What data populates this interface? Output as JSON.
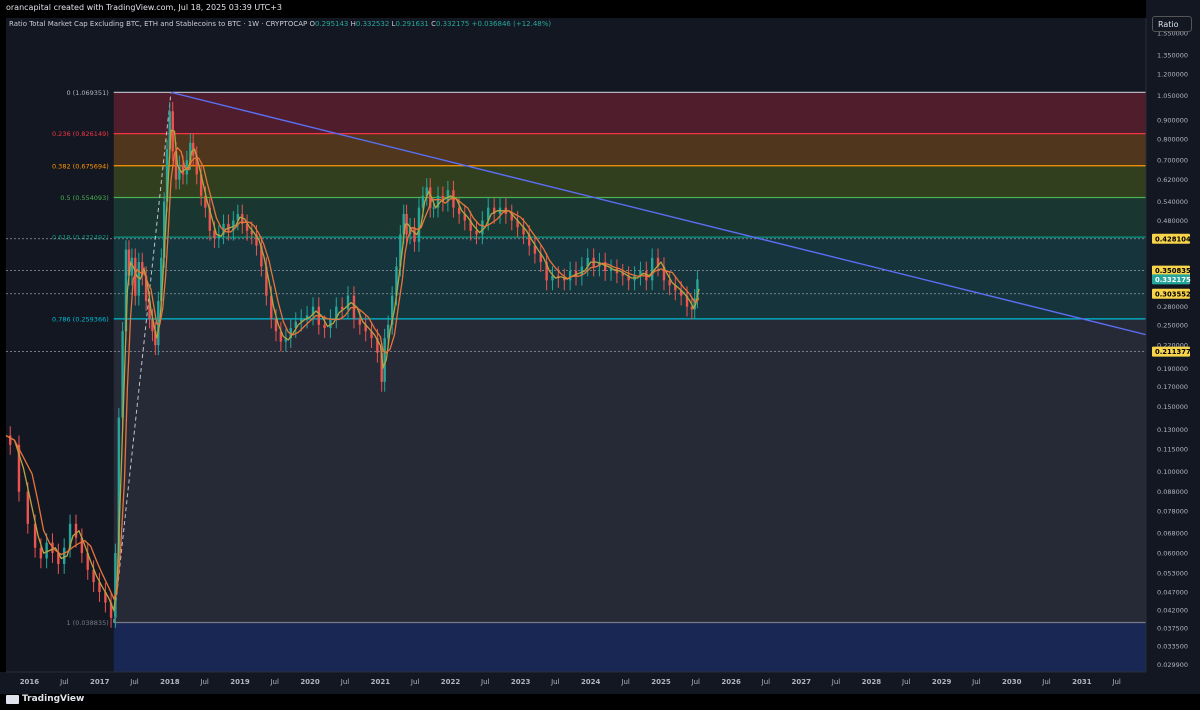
{
  "header": {
    "creator_text": "orancapital created with TradingView.com, Jul 18, 2025 03:39 UTC+3"
  },
  "legend": {
    "symbol": "Ratio Total Market Cap Excluding BTC, ETH and Stablecoins to BTC · 1W · CRYPTOCAP",
    "open_label": "O",
    "open": "0.295143",
    "high_label": "H",
    "high": "0.332532",
    "low_label": "L",
    "low": "0.291631",
    "close_label": "C",
    "close": "0.332175",
    "change": "+0.036846 (+12.48%)"
  },
  "axis_label": "Ratio",
  "brand": "TradingView",
  "colors": {
    "background": "#000000",
    "up": "#26a69a",
    "down": "#ef5350",
    "trendline": "#5b6ef5",
    "ma_fast": "#b5a642",
    "ma_slow": "#e8743b"
  },
  "chart_data": {
    "type": "candlestick",
    "title": "Ratio Total Market Cap Excluding BTC, ETH and Stablecoins to BTC · 1W · CRYPTOCAP",
    "scale": "log",
    "ylabel": "Ratio",
    "ylim": [
      0.0285,
      1.56
    ],
    "xlim": [
      "2015-09-01",
      "2031-12-01"
    ],
    "y_ticks": [
      "1.550000",
      "1.350000",
      "1.200000",
      "1.050000",
      "0.900000",
      "0.800000",
      "0.700000",
      "0.620000",
      "0.540000",
      "0.480000",
      "0.350000",
      "0.280000",
      "0.250000",
      "0.220000",
      "0.190000",
      "0.170000",
      "0.150000",
      "0.130000",
      "0.115000",
      "0.100000",
      "0.088000",
      "0.078000",
      "0.068000",
      "0.060000",
      "0.053000",
      "0.047000",
      "0.042000",
      "0.037500",
      "0.033500",
      "0.029900"
    ],
    "x_ticks": [
      {
        "label": "2016",
        "date": "2016-01-01"
      },
      {
        "label": "Jul",
        "date": "2016-07-01"
      },
      {
        "label": "2017",
        "date": "2017-01-01"
      },
      {
        "label": "Jul",
        "date": "2017-07-01"
      },
      {
        "label": "2018",
        "date": "2018-01-01"
      },
      {
        "label": "Jul",
        "date": "2018-07-01"
      },
      {
        "label": "2019",
        "date": "2019-01-01"
      },
      {
        "label": "Jul",
        "date": "2019-07-01"
      },
      {
        "label": "2020",
        "date": "2020-01-01"
      },
      {
        "label": "Jul",
        "date": "2020-07-01"
      },
      {
        "label": "2021",
        "date": "2021-01-01"
      },
      {
        "label": "Jul",
        "date": "2021-07-01"
      },
      {
        "label": "2022",
        "date": "2022-01-01"
      },
      {
        "label": "Jul",
        "date": "2022-07-01"
      },
      {
        "label": "2023",
        "date": "2023-01-01"
      },
      {
        "label": "Jul",
        "date": "2023-07-01"
      },
      {
        "label": "2024",
        "date": "2024-01-01"
      },
      {
        "label": "Jul",
        "date": "2024-07-01"
      },
      {
        "label": "2025",
        "date": "2025-01-01"
      },
      {
        "label": "Jul",
        "date": "2025-07-01"
      },
      {
        "label": "2026",
        "date": "2026-01-01"
      },
      {
        "label": "Jul",
        "date": "2026-07-01"
      },
      {
        "label": "2027",
        "date": "2027-01-01"
      },
      {
        "label": "Jul",
        "date": "2027-07-01"
      },
      {
        "label": "2028",
        "date": "2028-01-01"
      },
      {
        "label": "Jul",
        "date": "2028-07-01"
      },
      {
        "label": "2029",
        "date": "2029-01-01"
      },
      {
        "label": "Jul",
        "date": "2029-07-01"
      },
      {
        "label": "2030",
        "date": "2030-01-01"
      },
      {
        "label": "Jul",
        "date": "2030-07-01"
      },
      {
        "label": "2031",
        "date": "2031-01-01"
      },
      {
        "label": "Jul",
        "date": "2031-07-01"
      }
    ],
    "fib_levels": [
      {
        "label": "0 (1.069351)",
        "value": 1.069351,
        "color": "#b2b5be",
        "fill": "#5c1f2e"
      },
      {
        "label": "0.236 (0.826149)",
        "value": 0.826149,
        "color": "#f23645",
        "fill": "#5a3c1c"
      },
      {
        "label": "0.382 (0.675694)",
        "value": 0.675694,
        "color": "#ff9800",
        "fill": "#37461f"
      },
      {
        "label": "0.5 (0.554093)",
        "value": 0.554093,
        "color": "#4caf50",
        "fill": "#1b3d33"
      },
      {
        "label": "0.618 (0.432492)",
        "value": 0.432492,
        "color": "#089981",
        "fill": "#173a40"
      },
      {
        "label": "0.786 (0.259366)",
        "value": 0.259366,
        "color": "#00bcd4",
        "fill": "#2a2e39"
      },
      {
        "label": "1 (0.038835)",
        "value": 0.038835,
        "color": "#787b86",
        "fill": "#1a2a5c"
      }
    ],
    "fib_range": {
      "start": "2017-03-15",
      "end": "2031-12-01"
    },
    "price_markers": [
      {
        "value": "0.428104",
        "bg": "#f7d44a",
        "fg": "#000000"
      },
      {
        "value": "0.350835",
        "bg": "#f7d44a",
        "fg": "#000000"
      },
      {
        "value": "0.332175",
        "bg": "#26a69a",
        "fg": "#ffffff"
      },
      {
        "value": "0.303552",
        "bg": "#f7d44a",
        "fg": "#000000"
      },
      {
        "value": "0.211377",
        "bg": "#f7d44a",
        "fg": "#000000"
      }
    ],
    "horizontal_lines": [
      0.428104,
      0.350835,
      0.303552,
      0.211377
    ],
    "trendline": {
      "from": {
        "date": "2018-01-07",
        "value": 1.069351
      },
      "to": {
        "date": "2031-12-01",
        "value": 0.235
      }
    },
    "dashed_projection": {
      "from": {
        "date": "2017-03-15",
        "value": 0.038835
      },
      "to": {
        "date": "2018-01-07",
        "value": 1.069351
      }
    },
    "close_path": [
      [
        "2015-09-01",
        0.125
      ],
      [
        "2015-10-15",
        0.118
      ],
      [
        "2015-12-01",
        0.088
      ],
      [
        "2016-01-15",
        0.072
      ],
      [
        "2016-02-15",
        0.062
      ],
      [
        "2016-03-15",
        0.058
      ],
      [
        "2016-04-15",
        0.064
      ],
      [
        "2016-05-15",
        0.06
      ],
      [
        "2016-06-15",
        0.056
      ],
      [
        "2016-07-15",
        0.062
      ],
      [
        "2016-08-15",
        0.072
      ],
      [
        "2016-09-15",
        0.066
      ],
      [
        "2016-10-15",
        0.06
      ],
      [
        "2016-11-15",
        0.054
      ],
      [
        "2016-12-15",
        0.05
      ],
      [
        "2017-01-15",
        0.047
      ],
      [
        "2017-02-15",
        0.044
      ],
      [
        "2017-03-15",
        0.04
      ],
      [
        "2017-04-01",
        0.06
      ],
      [
        "2017-04-20",
        0.14
      ],
      [
        "2017-05-10",
        0.24
      ],
      [
        "2017-05-25",
        0.4
      ],
      [
        "2017-06-10",
        0.34
      ],
      [
        "2017-06-25",
        0.38
      ],
      [
        "2017-07-15",
        0.3
      ],
      [
        "2017-08-01",
        0.37
      ],
      [
        "2017-08-20",
        0.34
      ],
      [
        "2017-09-10",
        0.29
      ],
      [
        "2017-09-25",
        0.26
      ],
      [
        "2017-10-10",
        0.24
      ],
      [
        "2017-10-25",
        0.22
      ],
      [
        "2017-11-10",
        0.29
      ],
      [
        "2017-11-25",
        0.38
      ],
      [
        "2017-12-10",
        0.54
      ],
      [
        "2017-12-25",
        0.75
      ],
      [
        "2018-01-07",
        0.95
      ],
      [
        "2018-01-25",
        0.74
      ],
      [
        "2018-02-10",
        0.62
      ],
      [
        "2018-03-01",
        0.68
      ],
      [
        "2018-03-20",
        0.64
      ],
      [
        "2018-04-10",
        0.7
      ],
      [
        "2018-04-25",
        0.78
      ],
      [
        "2018-05-10",
        0.72
      ],
      [
        "2018-06-01",
        0.64
      ],
      [
        "2018-06-25",
        0.56
      ],
      [
        "2018-07-15",
        0.52
      ],
      [
        "2018-08-10",
        0.45
      ],
      [
        "2018-09-01",
        0.43
      ],
      [
        "2018-09-25",
        0.44
      ],
      [
        "2018-10-20",
        0.47
      ],
      [
        "2018-11-15",
        0.45
      ],
      [
        "2018-12-10",
        0.48
      ],
      [
        "2019-01-01",
        0.5
      ],
      [
        "2019-01-25",
        0.47
      ],
      [
        "2019-02-20",
        0.45
      ],
      [
        "2019-03-15",
        0.44
      ],
      [
        "2019-04-10",
        0.41
      ],
      [
        "2019-05-05",
        0.36
      ],
      [
        "2019-06-01",
        0.3
      ],
      [
        "2019-06-25",
        0.26
      ],
      [
        "2019-07-20",
        0.24
      ],
      [
        "2019-08-15",
        0.225
      ],
      [
        "2019-09-10",
        0.23
      ],
      [
        "2019-10-05",
        0.245
      ],
      [
        "2019-11-01",
        0.255
      ],
      [
        "2019-12-01",
        0.26
      ],
      [
        "2020-01-01",
        0.265
      ],
      [
        "2020-02-01",
        0.28
      ],
      [
        "2020-03-01",
        0.25
      ],
      [
        "2020-04-01",
        0.245
      ],
      [
        "2020-05-01",
        0.26
      ],
      [
        "2020-06-01",
        0.28
      ],
      [
        "2020-07-01",
        0.275
      ],
      [
        "2020-08-01",
        0.3
      ],
      [
        "2020-09-01",
        0.26
      ],
      [
        "2020-10-01",
        0.25
      ],
      [
        "2020-11-01",
        0.24
      ],
      [
        "2020-12-01",
        0.23
      ],
      [
        "2021-01-01",
        0.21
      ],
      [
        "2021-01-15",
        0.175
      ],
      [
        "2021-02-01",
        0.23
      ],
      [
        "2021-02-20",
        0.25
      ],
      [
        "2021-03-15",
        0.3
      ],
      [
        "2021-04-05",
        0.36
      ],
      [
        "2021-04-25",
        0.44
      ],
      [
        "2021-05-10",
        0.5
      ],
      [
        "2021-05-25",
        0.44
      ],
      [
        "2021-06-15",
        0.46
      ],
      [
        "2021-07-10",
        0.42
      ],
      [
        "2021-08-01",
        0.52
      ],
      [
        "2021-08-20",
        0.56
      ],
      [
        "2021-09-10",
        0.59
      ],
      [
        "2021-09-25",
        0.52
      ],
      [
        "2021-10-15",
        0.52
      ],
      [
        "2021-11-10",
        0.56
      ],
      [
        "2021-12-05",
        0.54
      ],
      [
        "2022-01-01",
        0.58
      ],
      [
        "2022-02-01",
        0.52
      ],
      [
        "2022-03-01",
        0.5
      ],
      [
        "2022-04-01",
        0.48
      ],
      [
        "2022-05-01",
        0.45
      ],
      [
        "2022-06-01",
        0.44
      ],
      [
        "2022-07-01",
        0.48
      ],
      [
        "2022-08-01",
        0.52
      ],
      [
        "2022-09-01",
        0.5
      ],
      [
        "2022-10-01",
        0.52
      ],
      [
        "2022-11-01",
        0.5
      ],
      [
        "2022-12-01",
        0.48
      ],
      [
        "2023-01-01",
        0.46
      ],
      [
        "2023-02-01",
        0.44
      ],
      [
        "2023-03-01",
        0.41
      ],
      [
        "2023-04-01",
        0.39
      ],
      [
        "2023-05-01",
        0.37
      ],
      [
        "2023-06-01",
        0.33
      ],
      [
        "2023-07-01",
        0.34
      ],
      [
        "2023-08-01",
        0.335
      ],
      [
        "2023-09-01",
        0.33
      ],
      [
        "2023-10-01",
        0.35
      ],
      [
        "2023-11-01",
        0.34
      ],
      [
        "2023-12-01",
        0.36
      ],
      [
        "2024-01-01",
        0.38
      ],
      [
        "2024-02-01",
        0.36
      ],
      [
        "2024-03-01",
        0.37
      ],
      [
        "2024-04-01",
        0.35
      ],
      [
        "2024-05-01",
        0.355
      ],
      [
        "2024-06-01",
        0.345
      ],
      [
        "2024-07-01",
        0.34
      ],
      [
        "2024-08-01",
        0.33
      ],
      [
        "2024-09-01",
        0.34
      ],
      [
        "2024-10-01",
        0.35
      ],
      [
        "2024-11-01",
        0.33
      ],
      [
        "2024-12-01",
        0.38
      ],
      [
        "2025-01-01",
        0.36
      ],
      [
        "2025-02-01",
        0.33
      ],
      [
        "2025-03-01",
        0.32
      ],
      [
        "2025-04-01",
        0.31
      ],
      [
        "2025-05-01",
        0.3
      ],
      [
        "2025-06-01",
        0.28
      ],
      [
        "2025-06-20",
        0.275
      ],
      [
        "2025-07-01",
        0.295
      ],
      [
        "2025-07-18",
        0.332
      ]
    ]
  }
}
